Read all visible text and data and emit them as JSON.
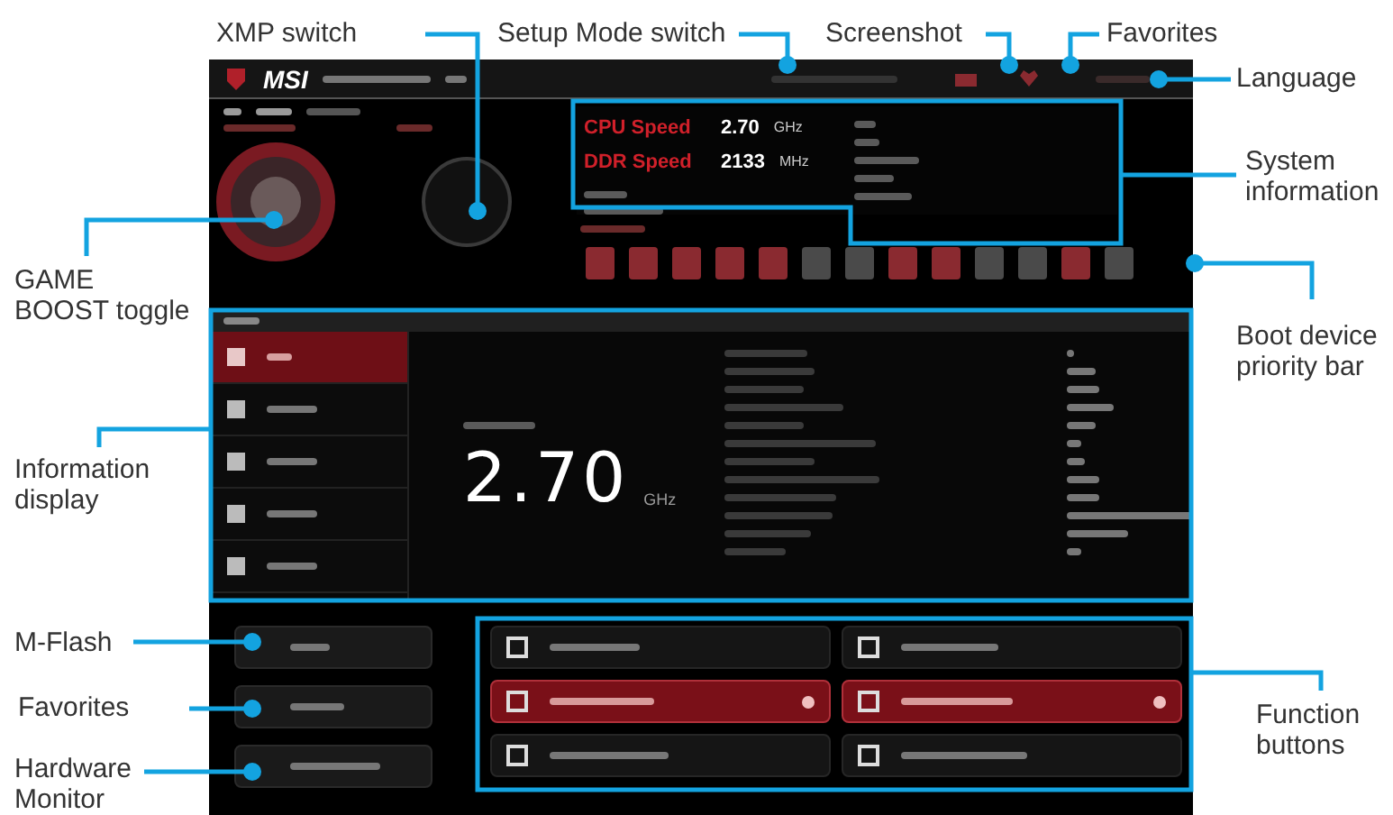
{
  "callouts": [
    {
      "label": "XMP switch"
    },
    {
      "label": "Setup Mode switch"
    },
    {
      "label": "Screenshot"
    },
    {
      "label": "Favorites"
    },
    {
      "label": "Language"
    },
    {
      "label": "System information"
    },
    {
      "label": "Boot device priority bar"
    },
    {
      "label": "GAME BOOST toggle"
    },
    {
      "label": "Information display"
    },
    {
      "label": "M-Flash"
    },
    {
      "label": "Favorites"
    },
    {
      "label": "Hardware Monitor"
    },
    {
      "label": "Function buttons"
    }
  ],
  "bios": {
    "logo": "MSI",
    "system_info": [
      {
        "label": "CPU Speed",
        "value": "2.70",
        "unit": "GHz"
      },
      {
        "label": "DDR Speed",
        "value": "2133",
        "unit": "MHz"
      }
    ],
    "info_menu": [
      {
        "selected": true
      },
      {
        "selected": false
      },
      {
        "selected": false
      },
      {
        "selected": false
      },
      {
        "selected": false
      }
    ],
    "frequency": {
      "value": "2.70",
      "unit": "GHz"
    },
    "function_buttons": [
      {
        "on": false
      },
      {
        "on": false
      },
      {
        "on": true
      },
      {
        "on": true
      },
      {
        "on": false
      },
      {
        "on": false
      }
    ]
  }
}
